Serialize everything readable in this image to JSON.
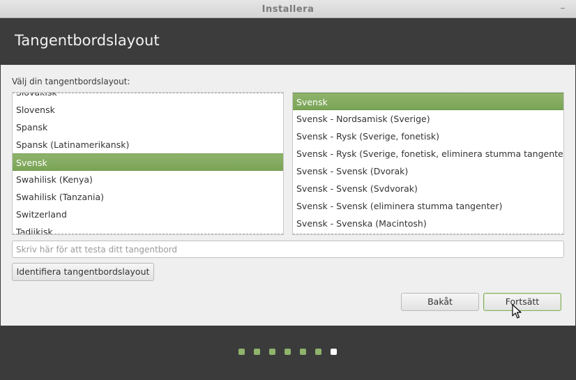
{
  "window": {
    "title": "Installera",
    "minimize_icon": "minimize-icon"
  },
  "header": {
    "title": "Tangentbordslayout"
  },
  "main": {
    "prompt": "Välj din tangentbordslayout:",
    "layouts": [
      {
        "label": "Slovakisk",
        "selected": false
      },
      {
        "label": "Slovensk",
        "selected": false
      },
      {
        "label": "Spansk",
        "selected": false
      },
      {
        "label": "Spansk (Latinamerikansk)",
        "selected": false
      },
      {
        "label": "Svensk",
        "selected": true
      },
      {
        "label": "Swahilisk (Kenya)",
        "selected": false
      },
      {
        "label": "Swahilisk (Tanzania)",
        "selected": false
      },
      {
        "label": "Switzerland",
        "selected": false
      },
      {
        "label": "Tadjikisk",
        "selected": false
      }
    ],
    "variants": [
      {
        "label": "Svensk",
        "selected": true
      },
      {
        "label": "Svensk - Nordsamisk (Sverige)",
        "selected": false
      },
      {
        "label": "Svensk - Rysk (Sverige, fonetisk)",
        "selected": false
      },
      {
        "label": "Svensk - Rysk (Sverige, fonetisk, eliminera stumma tangenter)",
        "selected": false
      },
      {
        "label": "Svensk - Svensk (Dvorak)",
        "selected": false
      },
      {
        "label": "Svensk - Svensk (Svdvorak)",
        "selected": false
      },
      {
        "label": "Svensk - Svensk (eliminera stumma tangenter)",
        "selected": false
      },
      {
        "label": "Svensk - Svenska (Macintosh)",
        "selected": false
      }
    ],
    "test_input": {
      "value": "",
      "placeholder": "Skriv här för att testa ditt tangentbord"
    },
    "detect_button": "Identifiera tangentbordslayout",
    "back_button": "Bakåt",
    "continue_button": "Fortsätt"
  },
  "progress": {
    "total_steps": 7,
    "current_step": 7
  },
  "colors": {
    "accent": "#8fb36c",
    "header_bg": "#3c3c3c",
    "content_bg": "#efefef"
  }
}
